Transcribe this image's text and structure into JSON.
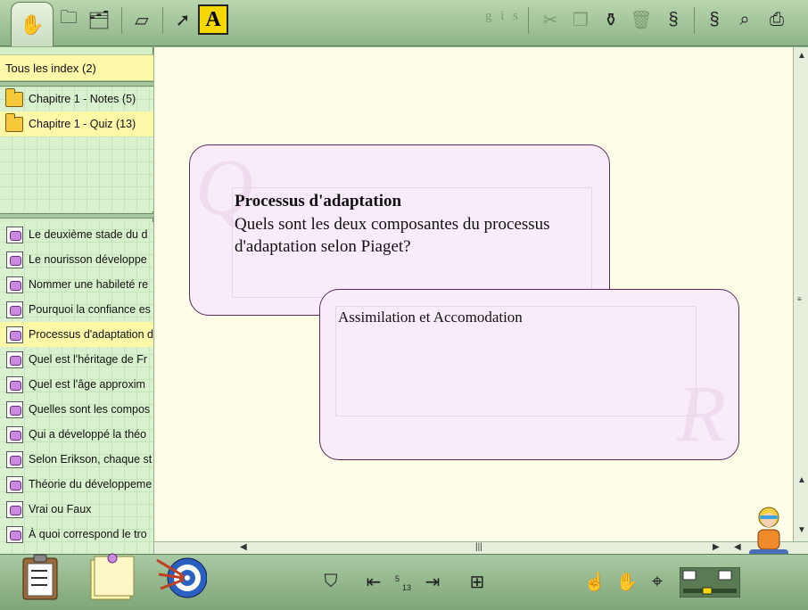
{
  "toolbar": {
    "gis_label": "g i s"
  },
  "index": {
    "all_label": "Tous les index (2)",
    "folders": [
      {
        "label": "Chapitre 1 - Notes (5)",
        "selected": false
      },
      {
        "label": "Chapitre 1 - Quiz (13)",
        "selected": true
      }
    ]
  },
  "cards": [
    {
      "label": "Le deuxième stade du d",
      "selected": false
    },
    {
      "label": "Le nourisson développe",
      "selected": false
    },
    {
      "label": "Nommer une habileté re",
      "selected": false
    },
    {
      "label": "Pourquoi la confiance es",
      "selected": false
    },
    {
      "label": "Processus d'adaptation d",
      "selected": true
    },
    {
      "label": "Quel est l'héritage de Fr",
      "selected": false
    },
    {
      "label": "Quel est l'âge approxim",
      "selected": false
    },
    {
      "label": "Quelles sont les compos",
      "selected": false
    },
    {
      "label": "Qui a développé la théo",
      "selected": false
    },
    {
      "label": "Selon Erikson, chaque st",
      "selected": false
    },
    {
      "label": "Théorie du développeme",
      "selected": false
    },
    {
      "label": "Vrai ou Faux",
      "selected": false
    },
    {
      "label": "À quoi correspond le tro",
      "selected": false
    }
  ],
  "question_card": {
    "watermark": "Q",
    "title": "Processus d'adaptation",
    "text": "Quels sont les deux composantes du processus d'adaptation selon Piaget?"
  },
  "answer_card": {
    "watermark": "R",
    "text": "Assimilation et Accomodation"
  },
  "pager": {
    "current": "5",
    "total": "13"
  },
  "colors": {
    "selection": "#fdf7a8",
    "card_bg": "#f9ecfa",
    "toolbar": "#8fb489"
  }
}
